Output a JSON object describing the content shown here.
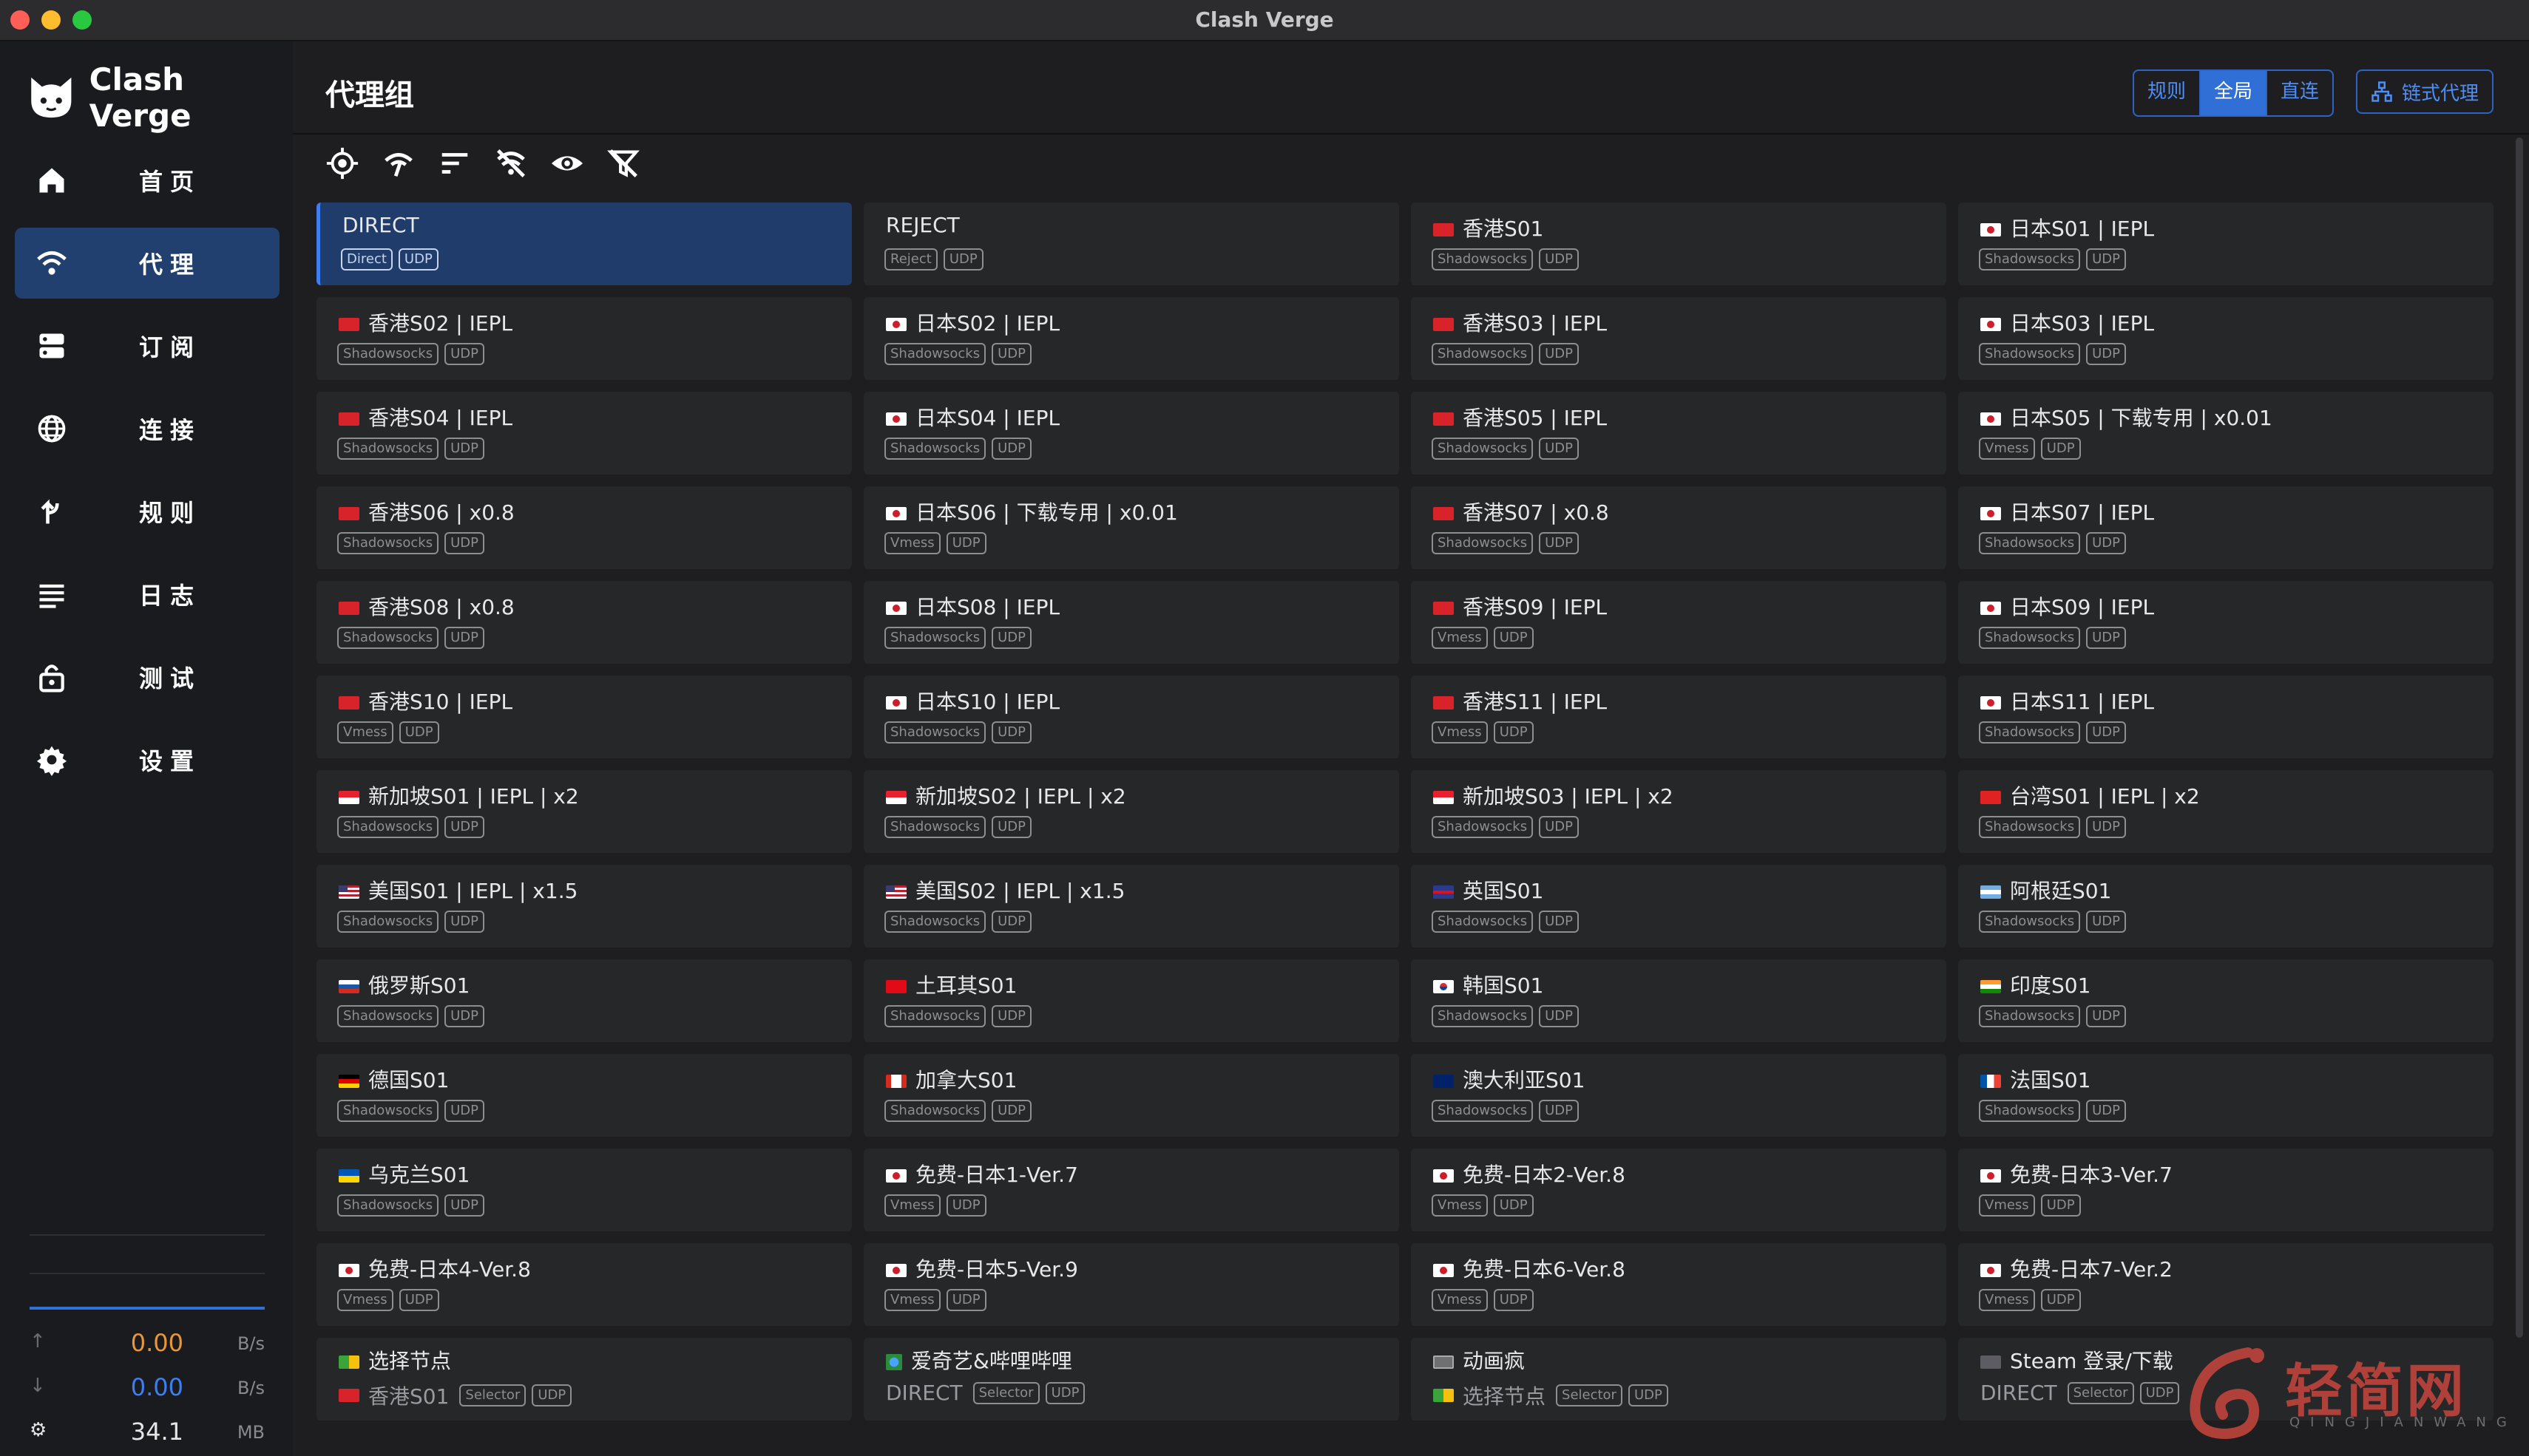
{
  "window": {
    "title": "Clash Verge"
  },
  "brand": {
    "name": "Clash Verge"
  },
  "nav": [
    {
      "label": "首页",
      "icon": "home-icon",
      "active": false
    },
    {
      "label": "代理",
      "icon": "wifi-icon",
      "active": true
    },
    {
      "label": "订阅",
      "icon": "storage-icon",
      "active": false
    },
    {
      "label": "连接",
      "icon": "globe-icon",
      "active": false
    },
    {
      "label": "规则",
      "icon": "fork-icon",
      "active": false
    },
    {
      "label": "日志",
      "icon": "list-icon",
      "active": false
    },
    {
      "label": "测试",
      "icon": "lock-icon",
      "active": false
    },
    {
      "label": "设置",
      "icon": "gear-icon",
      "active": false
    }
  ],
  "traffic": {
    "up": {
      "value": "0.00",
      "unit": "B/s"
    },
    "down": {
      "value": "0.00",
      "unit": "B/s"
    },
    "memory": {
      "value": "34.1",
      "unit": "MB"
    }
  },
  "header": {
    "title": "代理组",
    "modes": [
      {
        "label": "规则",
        "active": false
      },
      {
        "label": "全局",
        "active": true
      },
      {
        "label": "直连",
        "active": false
      }
    ],
    "chain_label": "链式代理"
  },
  "toolbar_icons": [
    "locate-icon",
    "speed-test-icon",
    "sort-icon",
    "filter-off-icon",
    "eye-icon",
    "filter-clear-icon"
  ],
  "accent_color": "#2f6fd6",
  "proxies": [
    {
      "name": "DIRECT",
      "type": "Direct",
      "udp": "UDP",
      "flag": "",
      "selected": true
    },
    {
      "name": "REJECT",
      "type": "Reject",
      "udp": "UDP",
      "flag": ""
    },
    {
      "name": "香港S01",
      "type": "Shadowsocks",
      "udp": "UDP",
      "flag": "hk"
    },
    {
      "name": "日本S01 | IEPL",
      "type": "Shadowsocks",
      "udp": "UDP",
      "flag": "jp"
    },
    {
      "name": "香港S02 | IEPL",
      "type": "Shadowsocks",
      "udp": "UDP",
      "flag": "hk"
    },
    {
      "name": "日本S02 | IEPL",
      "type": "Shadowsocks",
      "udp": "UDP",
      "flag": "jp"
    },
    {
      "name": "香港S03 | IEPL",
      "type": "Shadowsocks",
      "udp": "UDP",
      "flag": "hk"
    },
    {
      "name": "日本S03 | IEPL",
      "type": "Shadowsocks",
      "udp": "UDP",
      "flag": "jp"
    },
    {
      "name": "香港S04 | IEPL",
      "type": "Shadowsocks",
      "udp": "UDP",
      "flag": "hk"
    },
    {
      "name": "日本S04 | IEPL",
      "type": "Shadowsocks",
      "udp": "UDP",
      "flag": "jp"
    },
    {
      "name": "香港S05 | IEPL",
      "type": "Shadowsocks",
      "udp": "UDP",
      "flag": "hk"
    },
    {
      "name": "日本S05 | 下载专用 | x0.01",
      "type": "Vmess",
      "udp": "UDP",
      "flag": "jp"
    },
    {
      "name": "香港S06 | x0.8",
      "type": "Shadowsocks",
      "udp": "UDP",
      "flag": "hk"
    },
    {
      "name": "日本S06 | 下载专用 | x0.01",
      "type": "Vmess",
      "udp": "UDP",
      "flag": "jp"
    },
    {
      "name": "香港S07 | x0.8",
      "type": "Shadowsocks",
      "udp": "UDP",
      "flag": "hk"
    },
    {
      "name": "日本S07 | IEPL",
      "type": "Shadowsocks",
      "udp": "UDP",
      "flag": "jp"
    },
    {
      "name": "香港S08 | x0.8",
      "type": "Shadowsocks",
      "udp": "UDP",
      "flag": "hk"
    },
    {
      "name": "日本S08 | IEPL",
      "type": "Shadowsocks",
      "udp": "UDP",
      "flag": "jp"
    },
    {
      "name": "香港S09 | IEPL",
      "type": "Vmess",
      "udp": "UDP",
      "flag": "hk"
    },
    {
      "name": "日本S09 | IEPL",
      "type": "Shadowsocks",
      "udp": "UDP",
      "flag": "jp"
    },
    {
      "name": "香港S10 | IEPL",
      "type": "Vmess",
      "udp": "UDP",
      "flag": "hk"
    },
    {
      "name": "日本S10 | IEPL",
      "type": "Shadowsocks",
      "udp": "UDP",
      "flag": "jp"
    },
    {
      "name": "香港S11 | IEPL",
      "type": "Vmess",
      "udp": "UDP",
      "flag": "hk"
    },
    {
      "name": "日本S11 | IEPL",
      "type": "Shadowsocks",
      "udp": "UDP",
      "flag": "jp"
    },
    {
      "name": "新加坡S01 | IEPL | x2",
      "type": "Shadowsocks",
      "udp": "UDP",
      "flag": "sg"
    },
    {
      "name": "新加坡S02 | IEPL | x2",
      "type": "Shadowsocks",
      "udp": "UDP",
      "flag": "sg"
    },
    {
      "name": "新加坡S03 | IEPL | x2",
      "type": "Shadowsocks",
      "udp": "UDP",
      "flag": "sg"
    },
    {
      "name": "台湾S01 | IEPL | x2",
      "type": "Shadowsocks",
      "udp": "UDP",
      "flag": "tw"
    },
    {
      "name": "美国S01 | IEPL | x1.5",
      "type": "Shadowsocks",
      "udp": "UDP",
      "flag": "us"
    },
    {
      "name": "美国S02 | IEPL | x1.5",
      "type": "Shadowsocks",
      "udp": "UDP",
      "flag": "us"
    },
    {
      "name": "英国S01",
      "type": "Shadowsocks",
      "udp": "UDP",
      "flag": "uk"
    },
    {
      "name": "阿根廷S01",
      "type": "Shadowsocks",
      "udp": "UDP",
      "flag": "ar"
    },
    {
      "name": "俄罗斯S01",
      "type": "Shadowsocks",
      "udp": "UDP",
      "flag": "ru"
    },
    {
      "name": "土耳其S01",
      "type": "Shadowsocks",
      "udp": "UDP",
      "flag": "tr"
    },
    {
      "name": "韩国S01",
      "type": "Shadowsocks",
      "udp": "UDP",
      "flag": "kr"
    },
    {
      "name": "印度S01",
      "type": "Shadowsocks",
      "udp": "UDP",
      "flag": "in"
    },
    {
      "name": "德国S01",
      "type": "Shadowsocks",
      "udp": "UDP",
      "flag": "de"
    },
    {
      "name": "加拿大S01",
      "type": "Shadowsocks",
      "udp": "UDP",
      "flag": "ca"
    },
    {
      "name": "澳大利亚S01",
      "type": "Shadowsocks",
      "udp": "UDP",
      "flag": "au"
    },
    {
      "name": "法国S01",
      "type": "Shadowsocks",
      "udp": "UDP",
      "flag": "fr"
    },
    {
      "name": "乌克兰S01",
      "type": "Shadowsocks",
      "udp": "UDP",
      "flag": "ua"
    },
    {
      "name": "免费-日本1-Ver.7",
      "type": "Vmess",
      "udp": "UDP",
      "flag": "jp"
    },
    {
      "name": "免费-日本2-Ver.8",
      "type": "Vmess",
      "udp": "UDP",
      "flag": "jp"
    },
    {
      "name": "免费-日本3-Ver.7",
      "type": "Vmess",
      "udp": "UDP",
      "flag": "jp"
    },
    {
      "name": "免费-日本4-Ver.8",
      "type": "Vmess",
      "udp": "UDP",
      "flag": "jp"
    },
    {
      "name": "免费-日本5-Ver.9",
      "type": "Vmess",
      "udp": "UDP",
      "flag": "jp"
    },
    {
      "name": "免费-日本6-Ver.8",
      "type": "Vmess",
      "udp": "UDP",
      "flag": "jp"
    },
    {
      "name": "免费-日本7-Ver.2",
      "type": "Vmess",
      "udp": "UDP",
      "flag": "jp"
    }
  ],
  "groups": [
    {
      "name": "选择节点",
      "icon": "leaf",
      "now": "香港S01",
      "now_flag": "hk",
      "type": "Selector",
      "udp": "UDP"
    },
    {
      "name": "爱奇艺&哔哩哔哩",
      "icon": "globe",
      "now": "DIRECT",
      "now_flag": "",
      "type": "Selector",
      "udp": "UDP"
    },
    {
      "name": "动画疯",
      "icon": "tv",
      "now": "选择节点",
      "now_flag": "leaf",
      "type": "Selector",
      "udp": "UDP"
    },
    {
      "name": "Steam 登录/下载",
      "icon": "game",
      "now": "DIRECT",
      "now_flag": "",
      "type": "Selector",
      "udp": "UDP"
    }
  ],
  "watermark": {
    "text": "轻简网",
    "sub": "QINGJIANWANG"
  }
}
